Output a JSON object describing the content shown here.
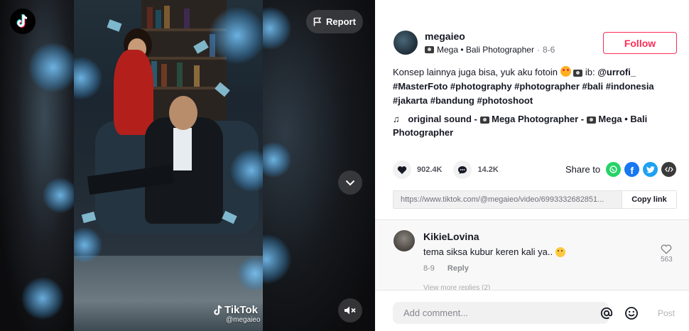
{
  "video": {
    "report_label": "Report",
    "watermark_brand": "TikTok",
    "watermark_user": "@megaieo"
  },
  "author": {
    "username": "megaieo",
    "display_name": "Mega • Bali Photographer",
    "date": "8-6"
  },
  "follow_label": "Follow",
  "description": {
    "line1_text": "Konsep lainnya juga bisa, yuk aku fotoin",
    "line1_ib": "ib:",
    "mention": "@urrofi_",
    "hashtags_line2": "#MasterFoto #photography #photographer #bali #indonesia",
    "hashtags_line3": "#jakarta #bandung #photoshoot"
  },
  "sound": {
    "text_a": "original sound -",
    "text_b": "Mega Photographer -",
    "text_c": "Mega • Bali",
    "text_d": "Photographer"
  },
  "stats": {
    "likes": "902.4K",
    "comments": "14.2K"
  },
  "share": {
    "label": "Share to",
    "icons": [
      "whatsapp-icon",
      "facebook-icon",
      "twitter-icon",
      "embed-icon"
    ],
    "colors": {
      "whatsapp": "#25d366",
      "facebook": "#1877f2",
      "twitter": "#1da1f2",
      "embed": "#3a3a3a"
    }
  },
  "link": {
    "url": "https://www.tiktok.com/@megaieo/video/6993332682851...",
    "copy_label": "Copy link"
  },
  "comment": {
    "user": "KikieLovina",
    "text": "tema siksa kubur keren kali ya..",
    "date": "8-9",
    "reply_label": "Reply",
    "likes": "563",
    "view_more": "View more replies (2)"
  },
  "composer": {
    "placeholder": "Add comment...",
    "post_label": "Post"
  },
  "colors": {
    "accent": "#fe2c55",
    "text": "#161823"
  }
}
